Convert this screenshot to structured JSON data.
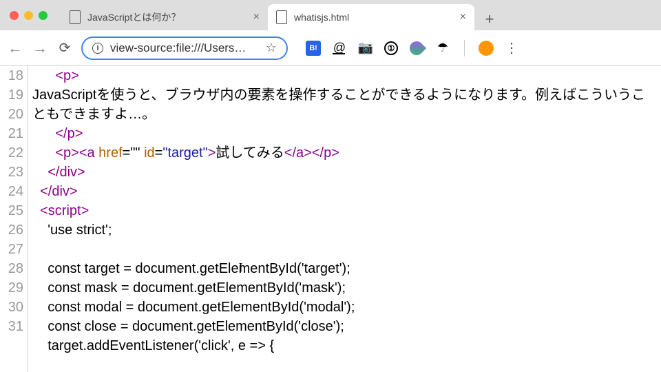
{
  "tabs": [
    {
      "label": "JavaScriptとは何か？"
    },
    {
      "label": "whatisjs.html"
    }
  ],
  "url": "view-source:file:///Users…",
  "ext": {
    "bi": "B!",
    "circled": "①"
  },
  "gutter_start": 18,
  "gutter_count": 14,
  "code": {
    "l18": {
      "pre": "      ",
      "t1": "<p>"
    },
    "l19": "        JavaScriptを使うと、ブラウザ内の要素を操作することができるようになります。例えばこういうこともできますよ…。",
    "l20": {
      "pre": "      ",
      "t1": "</p>"
    },
    "l21": {
      "pre": "      ",
      "t1": "<p>",
      "t2o": "<a ",
      "a1n": "href",
      "a1e": "=\"\"",
      "sp": " ",
      "a2n": "id",
      "a2e": "=",
      "a2v": "\"target\"",
      "t2c": ">",
      "txt": "試してみる",
      "c1": "</a>",
      "c2": "</p>"
    },
    "l22": {
      "pre": "    ",
      "t1": "</div>"
    },
    "l23": {
      "pre": "  ",
      "t1": "</div>"
    },
    "l24": {
      "pre": "  ",
      "t1": "<script>"
    },
    "l25": "    'use strict';",
    "l26": "",
    "l27a": "    const target = document.getEle",
    "l27b": "mentById('target');",
    "l28": "    const mask = document.getElementById('mask');",
    "l29": "    const modal = document.getElementById('modal');",
    "l30": "    const close = document.getElementById('close');",
    "l31": "    target.addEventListener('click', e => {"
  }
}
